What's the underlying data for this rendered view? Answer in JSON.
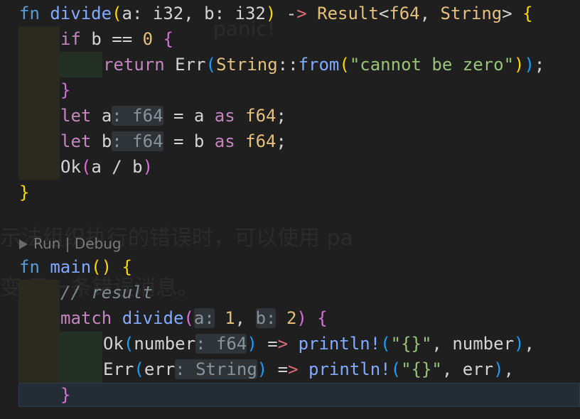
{
  "editor": {
    "codelens": {
      "run": "Run",
      "separator": "|",
      "debug": "Debug"
    },
    "ghost_text": {
      "line1": "示法组织执行的错误时，可以使用 pa",
      "line2": "变 示一条错误消息。",
      "line3": "panic!"
    },
    "code": {
      "l1": {
        "fn": "fn",
        "name": "divide",
        "p_open": "(",
        "a": "a",
        "colon1": ": ",
        "i32a": "i32",
        "comma1": ", ",
        "b": "b",
        "colon2": ": ",
        "i32b": "i32",
        "p_close": ")",
        "arrow_dash": " -",
        "arrow_gt": ">",
        "space": " ",
        "result": "Result",
        "lt": "<",
        "f64": "f64",
        "comma2": ", ",
        "string": "String",
        "gt": ">",
        "brace": "{"
      },
      "l2": {
        "if": "if",
        "rest": " b == ",
        "zero": "0",
        "brace": "{"
      },
      "l3": {
        "return": "return",
        "err": "Err",
        "p1": "(",
        "string": "String",
        "sep": "::",
        "from": "from",
        "p2": "(",
        "str": "\"cannot be zero\"",
        "p2c": ")",
        "p1c": ")",
        "semi": ";"
      },
      "l4": {
        "brace": "}"
      },
      "l5": {
        "let": "let",
        "var": "a",
        "hint": ": f64",
        "eq": " = a ",
        "as": "as",
        "ty": "f64",
        "semi": ";"
      },
      "l6": {
        "let": "let",
        "var": "b",
        "hint": ": f64",
        "eq": " = b ",
        "as": "as",
        "ty": "f64",
        "semi": ";"
      },
      "l7": {
        "ok": "Ok",
        "p": "(",
        "expr": "a / b",
        "pc": ")"
      },
      "l8": {
        "brace": "}"
      },
      "l9": {
        "fn": "fn",
        "name": "main",
        "parens": "()",
        "brace": "{"
      },
      "l10": {
        "comment": "// result"
      },
      "l11": {
        "match": "match",
        "divide": "divide",
        "p": "(",
        "hint_a": "a:",
        "one": "1",
        "comma": ", ",
        "hint_b": "b:",
        "two": "2",
        "pc": ")",
        "brace": "{"
      },
      "l12": {
        "ok": "Ok",
        "p": "(",
        "number": "number",
        "hint": ": f64",
        "pc": ")",
        "arrow_eq": " =",
        "arrow_gt": ">",
        "println": "println!",
        "p2": "(",
        "fmt": "\"{}\"",
        "args": ", number",
        "p2c": ")",
        "comma": ","
      },
      "l13": {
        "err": "Err",
        "p": "(",
        "errv": "err",
        "hint": ": String",
        "pc": ")",
        "arrow_eq": " =",
        "arrow_gt": ">",
        "println": "println!",
        "p2": "(",
        "fmt": "\"{}\"",
        "args": ", err",
        "p2c": ")",
        "comma": ","
      },
      "l14": {
        "brace": "}"
      }
    }
  }
}
